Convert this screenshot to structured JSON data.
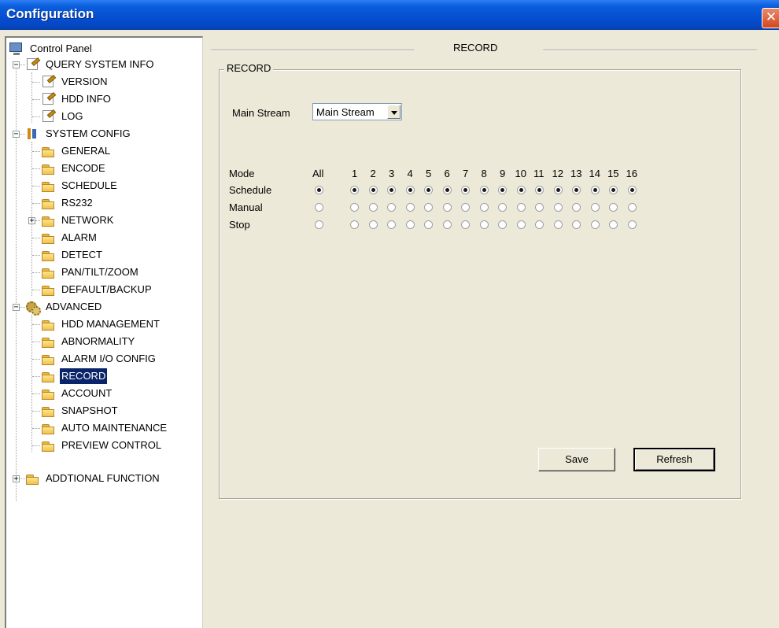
{
  "window": {
    "title": "Configuration",
    "close_icon": "close-icon"
  },
  "tree": {
    "root": "Control Panel",
    "groups": {
      "query": {
        "label": "QUERY SYSTEM INFO",
        "items": [
          "VERSION",
          "HDD INFO",
          "LOG"
        ]
      },
      "system": {
        "label": "SYSTEM CONFIG",
        "items": [
          "GENERAL",
          "ENCODE",
          "SCHEDULE",
          "RS232",
          "NETWORK",
          "ALARM",
          "DETECT",
          "PAN/TILT/ZOOM",
          "DEFAULT/BACKUP"
        ]
      },
      "advanced": {
        "label": "ADVANCED",
        "items": [
          "HDD MANAGEMENT",
          "ABNORMALITY",
          "ALARM I/O CONFIG",
          "RECORD",
          "ACCOUNT",
          "SNAPSHOT",
          "AUTO MAINTENANCE",
          "PREVIEW CONTROL"
        ]
      },
      "additional": {
        "label": "ADDTIONAL FUNCTION"
      }
    },
    "selected": "RECORD"
  },
  "record": {
    "heading": "RECORD",
    "group_label": "RECORD",
    "stream_label": "Main Stream",
    "stream_value": "Main Stream",
    "mode_label": "Mode",
    "all_label": "All",
    "channels": [
      "1",
      "2",
      "3",
      "4",
      "5",
      "6",
      "7",
      "8",
      "9",
      "10",
      "11",
      "12",
      "13",
      "14",
      "15",
      "16"
    ],
    "rows": [
      {
        "label": "Schedule",
        "selected": true
      },
      {
        "label": "Manual",
        "selected": false
      },
      {
        "label": "Stop",
        "selected": false
      }
    ],
    "save_label": "Save",
    "refresh_label": "Refresh"
  }
}
